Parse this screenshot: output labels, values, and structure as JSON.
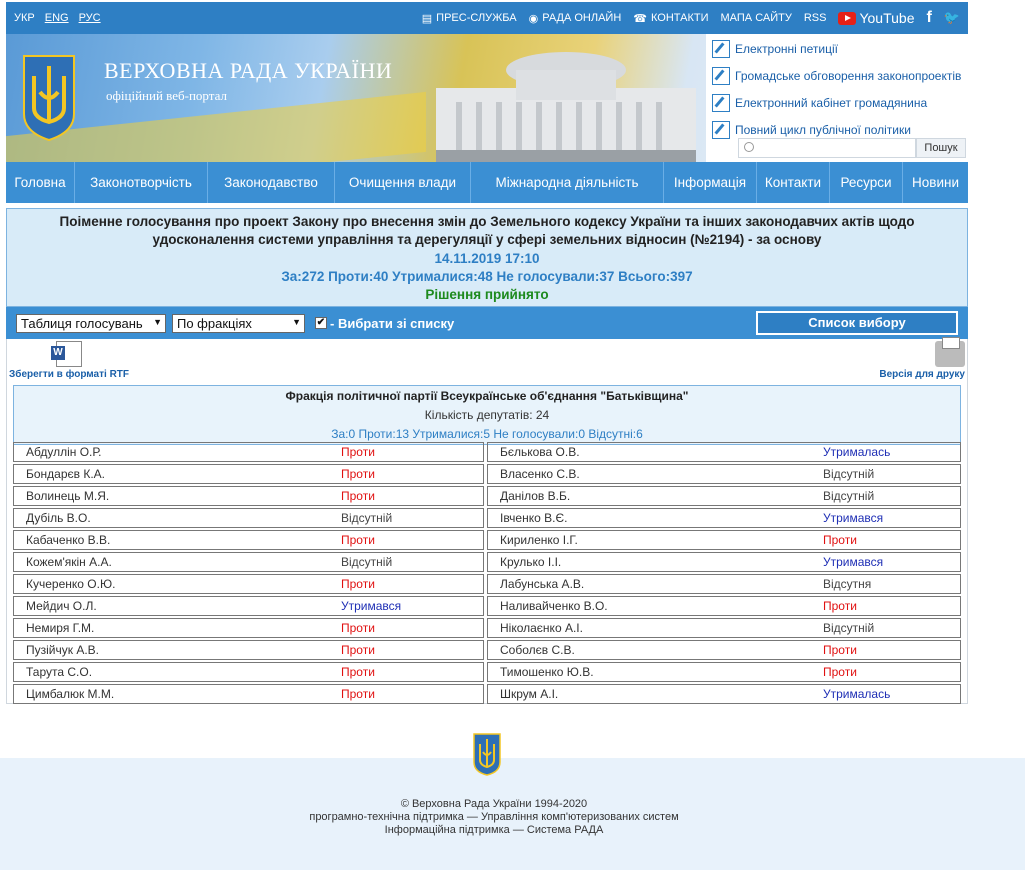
{
  "top": {
    "langs": [
      "УКР",
      "ENG",
      "РУС"
    ],
    "press": "ПРЕС-СЛУЖБА",
    "rada_online": "РАДА ОНЛАЙН",
    "contacts": "КОНТАКТИ",
    "sitemap": "МАПА САЙТУ",
    "rss": "RSS",
    "youtube": "YouTube",
    "facebook": "f",
    "twitter": "🐦"
  },
  "header": {
    "title": "ВЕРХОВНА РАДА УКРАЇНИ",
    "subtitle": "офіційний веб-портал",
    "links": [
      "Електронні петиції",
      "Громадське обговорення законопроектів",
      "Електронний кабінет громадянина",
      "Повний цикл публічної політики"
    ],
    "search_placeholder": "",
    "search_button": "Пошук"
  },
  "nav": [
    "Головна",
    "Законотворчість",
    "Законодавство",
    "Очищення влади",
    "Міжнародна діяльність",
    "Інформація",
    "Контакти",
    "Ресурси",
    "Новини"
  ],
  "vote": {
    "title": "Поіменне голосування про проект Закону про внесення змін до Земельного кодексу України та інших законодавчих актів щодо удосконалення системи управління та дерегуляції у сфері земельних відносин (№2194) - за основу",
    "datetime": "14.11.2019 17:10",
    "summary": "За:272 Проти:40 Утрималися:48 Не голосували:37 Всього:397",
    "result": "Рішення прийнято"
  },
  "controls": {
    "view_select": "Таблиця голосувань",
    "group_select": "По фракціях",
    "checkbox_label": "- Вибрати зі списку",
    "list_button": "Список вибору"
  },
  "tools": {
    "rtf_label": "Зберегти в форматі RTF",
    "print_label": "Версія для друку"
  },
  "faction": {
    "name": "Фракція політичної партії Всеукраїнське об'єднання \"Батьківщина\"",
    "count": "Кількість депутатів: 24",
    "summary": "За:0 Проти:13 Утрималися:5 Не голосували:0 Відсутні:6"
  },
  "deputies_left": [
    {
      "name": "Абдуллін О.Р.",
      "vote": "Проти",
      "type": "proty"
    },
    {
      "name": "Бондарєв К.А.",
      "vote": "Проти",
      "type": "proty"
    },
    {
      "name": "Волинець М.Я.",
      "vote": "Проти",
      "type": "proty"
    },
    {
      "name": "Дубіль В.О.",
      "vote": "Відсутній",
      "type": "vids"
    },
    {
      "name": "Кабаченко В.В.",
      "vote": "Проти",
      "type": "proty"
    },
    {
      "name": "Кожем'якін А.А.",
      "vote": "Відсутній",
      "type": "vids"
    },
    {
      "name": "Кучеренко О.Ю.",
      "vote": "Проти",
      "type": "proty"
    },
    {
      "name": "Мейдич О.Л.",
      "vote": "Утримався",
      "type": "utr"
    },
    {
      "name": "Немиря Г.М.",
      "vote": "Проти",
      "type": "proty"
    },
    {
      "name": "Пузійчук А.В.",
      "vote": "Проти",
      "type": "proty"
    },
    {
      "name": "Тарута С.О.",
      "vote": "Проти",
      "type": "proty"
    },
    {
      "name": "Цимбалюк М.М.",
      "vote": "Проти",
      "type": "proty"
    }
  ],
  "deputies_right": [
    {
      "name": "Бєлькова О.В.",
      "vote": "Утрималась",
      "type": "utr"
    },
    {
      "name": "Власенко С.В.",
      "vote": "Відсутній",
      "type": "vids"
    },
    {
      "name": "Данілов В.Б.",
      "vote": "Відсутній",
      "type": "vids"
    },
    {
      "name": "Івченко В.Є.",
      "vote": "Утримався",
      "type": "utr"
    },
    {
      "name": "Кириленко І.Г.",
      "vote": "Проти",
      "type": "proty"
    },
    {
      "name": "Крулько І.І.",
      "vote": "Утримався",
      "type": "utr"
    },
    {
      "name": "Лабунська А.В.",
      "vote": "Відсутня",
      "type": "vids"
    },
    {
      "name": "Наливайченко В.О.",
      "vote": "Проти",
      "type": "proty"
    },
    {
      "name": "Ніколаєнко А.І.",
      "vote": "Відсутній",
      "type": "vids"
    },
    {
      "name": "Соболєв С.В.",
      "vote": "Проти",
      "type": "proty"
    },
    {
      "name": "Тимошенко Ю.В.",
      "vote": "Проти",
      "type": "proty"
    },
    {
      "name": "Шкрум А.І.",
      "vote": "Утрималась",
      "type": "utr"
    }
  ],
  "footer": {
    "line1": "© Верховна Рада України 1994-2020",
    "line2": "програмно-технічна підтримка — Управління комп'ютеризованих систем",
    "line3": "Інформаційна підтримка — Система РАДА"
  },
  "colors": {
    "primary_blue": "#3b8fd3",
    "vote_against": "#e01010",
    "vote_abstain": "#1f2fb5",
    "result_green": "#1d8a1d"
  }
}
